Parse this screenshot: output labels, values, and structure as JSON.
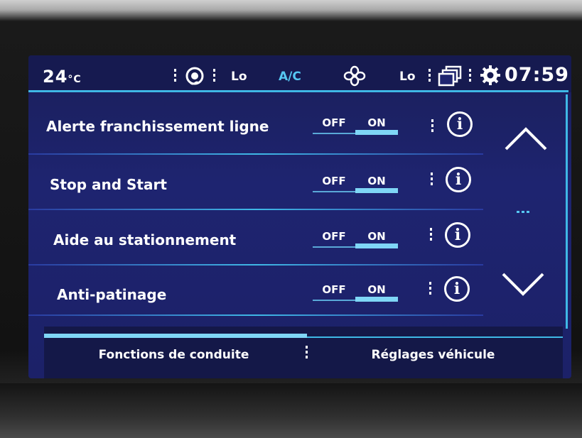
{
  "status_bar": {
    "temperature": "24",
    "temperature_unit": "°C",
    "fan_left_level": "Lo",
    "ac_label": "A/C",
    "fan_right_level": "Lo",
    "clock": "07:59",
    "icons": [
      "seat-heating-icon",
      "fan-icon",
      "windows-icon",
      "settings-gear-icon"
    ]
  },
  "settings": {
    "off_label": "OFF",
    "on_label": "ON",
    "info_glyph": "i",
    "items": [
      {
        "label": "Alerte franchissement ligne",
        "state": "ON"
      },
      {
        "label": "Stop and Start",
        "state": "ON"
      },
      {
        "label": "Aide au stationnement",
        "state": "ON"
      },
      {
        "label": "Anti-patinage",
        "state": "ON"
      }
    ]
  },
  "tabs": [
    {
      "label": "Fonctions de conduite",
      "active": true
    },
    {
      "label": "Réglages véhicule",
      "active": false
    }
  ],
  "colors": {
    "screen_bg": "#1e2470",
    "accent": "#3fb8e6",
    "accent_light": "#7fd6f6",
    "text": "#ffffff"
  }
}
